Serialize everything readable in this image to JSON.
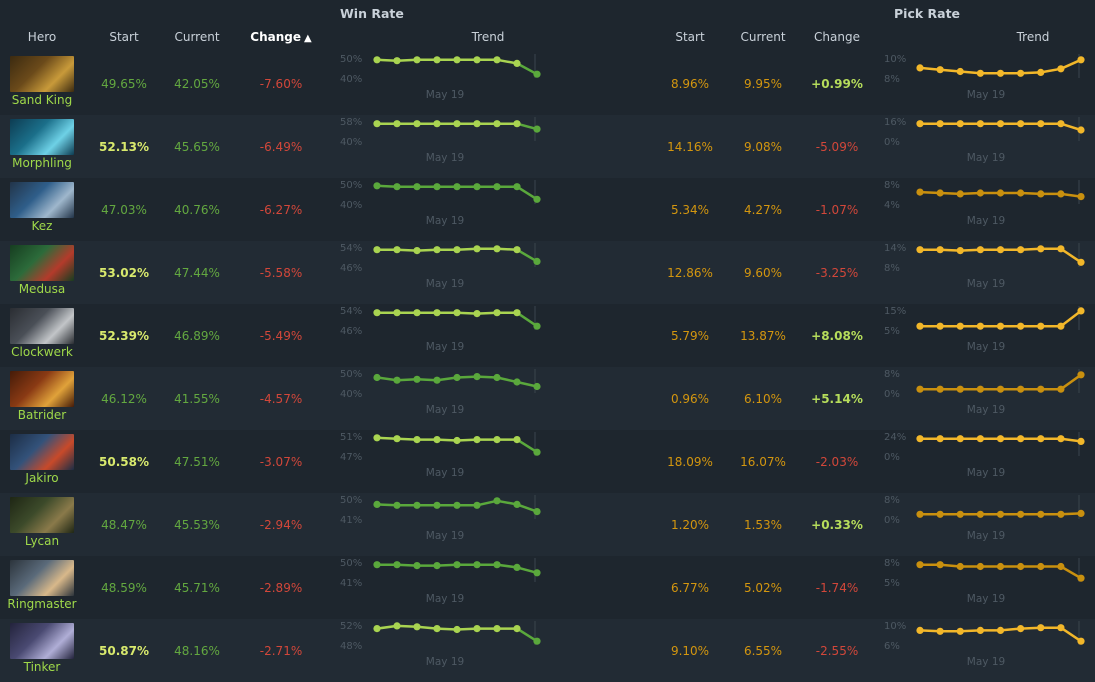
{
  "groups": {
    "win_rate": "Win Rate",
    "pick_rate": "Pick Rate"
  },
  "headers": {
    "hero": "Hero",
    "wr_start": "Start",
    "wr_current": "Current",
    "wr_change": "Change",
    "wr_trend": "Trend",
    "pr_start": "Start",
    "pr_current": "Current",
    "pr_change": "Change",
    "pr_trend": "Trend"
  },
  "sort_indicator": "▲",
  "colors": {
    "win_line": "#5aa83c",
    "win_last": "#b7e05a",
    "pick_line": "#c9900f",
    "pick_last": "#f2b72a",
    "negative": "#d2473a",
    "positive": "#b6dd5b"
  },
  "rows": [
    {
      "hero": "Sand King",
      "portrait": "sand-king",
      "wr_start": "49.65%",
      "wr_current": "42.05%",
      "wr_change": "-7.60%",
      "wr_hi": "50%",
      "wr_lo": "40%",
      "wr_date": "May 19",
      "pr_start": "8.96%",
      "pr_current": "9.95%",
      "pr_change": "+0.99%",
      "pr_hi": "10%",
      "pr_lo": "8%",
      "pr_date": "May 19",
      "wr_trend": [
        0.9,
        0.85,
        0.9,
        0.9,
        0.9,
        0.9,
        0.9,
        0.7,
        0.1
      ],
      "pr_trend": [
        0.45,
        0.35,
        0.25,
        0.15,
        0.15,
        0.15,
        0.2,
        0.4,
        0.9
      ],
      "wr_strong": false,
      "wr_bright": true,
      "pr_bright": true
    },
    {
      "hero": "Morphling",
      "portrait": "morphling",
      "wr_start": "52.13%",
      "wr_current": "45.65%",
      "wr_change": "-6.49%",
      "wr_hi": "58%",
      "wr_lo": "40%",
      "wr_date": "May 19",
      "pr_start": "14.16%",
      "pr_current": "9.08%",
      "pr_change": "-5.09%",
      "pr_hi": "16%",
      "pr_lo": "0%",
      "pr_date": "May 19",
      "wr_trend": [
        0.85,
        0.85,
        0.85,
        0.85,
        0.85,
        0.85,
        0.85,
        0.85,
        0.55
      ],
      "pr_trend": [
        0.85,
        0.85,
        0.85,
        0.85,
        0.85,
        0.85,
        0.85,
        0.85,
        0.5
      ],
      "wr_strong": true,
      "wr_bright": true,
      "pr_bright": true
    },
    {
      "hero": "Kez",
      "portrait": "kez",
      "wr_start": "47.03%",
      "wr_current": "40.76%",
      "wr_change": "-6.27%",
      "wr_hi": "50%",
      "wr_lo": "40%",
      "wr_date": "May 19",
      "pr_start": "5.34%",
      "pr_current": "4.27%",
      "pr_change": "-1.07%",
      "pr_hi": "8%",
      "pr_lo": "4%",
      "pr_date": "May 19",
      "wr_trend": [
        0.9,
        0.85,
        0.85,
        0.85,
        0.85,
        0.85,
        0.85,
        0.85,
        0.15
      ],
      "pr_trend": [
        0.55,
        0.5,
        0.45,
        0.5,
        0.5,
        0.5,
        0.45,
        0.45,
        0.3
      ],
      "wr_strong": false,
      "wr_bright": false,
      "pr_bright": false
    },
    {
      "hero": "Medusa",
      "portrait": "medusa",
      "wr_start": "53.02%",
      "wr_current": "47.44%",
      "wr_change": "-5.58%",
      "wr_hi": "54%",
      "wr_lo": "46%",
      "wr_date": "May 19",
      "pr_start": "12.86%",
      "pr_current": "9.60%",
      "pr_change": "-3.25%",
      "pr_hi": "14%",
      "pr_lo": "8%",
      "pr_date": "May 19",
      "wr_trend": [
        0.85,
        0.85,
        0.8,
        0.85,
        0.85,
        0.9,
        0.9,
        0.85,
        0.2
      ],
      "pr_trend": [
        0.85,
        0.85,
        0.8,
        0.85,
        0.85,
        0.85,
        0.9,
        0.9,
        0.15
      ],
      "wr_strong": true,
      "wr_bright": true,
      "pr_bright": true
    },
    {
      "hero": "Clockwerk",
      "portrait": "clockwerk",
      "wr_start": "52.39%",
      "wr_current": "46.89%",
      "wr_change": "-5.49%",
      "wr_hi": "54%",
      "wr_lo": "46%",
      "wr_date": "May 19",
      "pr_start": "5.79%",
      "pr_current": "13.87%",
      "pr_change": "+8.08%",
      "pr_hi": "15%",
      "pr_lo": "5%",
      "pr_date": "May 19",
      "wr_trend": [
        0.85,
        0.85,
        0.85,
        0.85,
        0.85,
        0.8,
        0.85,
        0.85,
        0.1
      ],
      "pr_trend": [
        0.1,
        0.1,
        0.1,
        0.1,
        0.1,
        0.1,
        0.1,
        0.1,
        0.95
      ],
      "wr_strong": true,
      "wr_bright": true,
      "pr_bright": true
    },
    {
      "hero": "Batrider",
      "portrait": "batrider",
      "wr_start": "46.12%",
      "wr_current": "41.55%",
      "wr_change": "-4.57%",
      "wr_hi": "50%",
      "wr_lo": "40%",
      "wr_date": "May 19",
      "pr_start": "0.96%",
      "pr_current": "6.10%",
      "pr_change": "+5.14%",
      "pr_hi": "8%",
      "pr_lo": "0%",
      "pr_date": "May 19",
      "wr_trend": [
        0.75,
        0.6,
        0.65,
        0.6,
        0.75,
        0.8,
        0.75,
        0.5,
        0.25
      ],
      "pr_trend": [
        0.1,
        0.1,
        0.1,
        0.1,
        0.1,
        0.1,
        0.1,
        0.1,
        0.9
      ],
      "wr_strong": false,
      "wr_bright": false,
      "pr_bright": false
    },
    {
      "hero": "Jakiro",
      "portrait": "jakiro",
      "wr_start": "50.58%",
      "wr_current": "47.51%",
      "wr_change": "-3.07%",
      "wr_hi": "51%",
      "wr_lo": "47%",
      "wr_date": "May 19",
      "pr_start": "18.09%",
      "pr_current": "16.07%",
      "pr_change": "-2.03%",
      "pr_hi": "24%",
      "pr_lo": "0%",
      "pr_date": "May 19",
      "wr_trend": [
        0.9,
        0.85,
        0.8,
        0.8,
        0.75,
        0.8,
        0.8,
        0.8,
        0.1
      ],
      "pr_trend": [
        0.85,
        0.85,
        0.85,
        0.85,
        0.85,
        0.85,
        0.85,
        0.85,
        0.7
      ],
      "wr_strong": true,
      "wr_bright": true,
      "pr_bright": true
    },
    {
      "hero": "Lycan",
      "portrait": "lycan",
      "wr_start": "48.47%",
      "wr_current": "45.53%",
      "wr_change": "-2.94%",
      "wr_hi": "50%",
      "wr_lo": "41%",
      "wr_date": "May 19",
      "pr_start": "1.20%",
      "pr_current": "1.53%",
      "pr_change": "+0.33%",
      "pr_hi": "8%",
      "pr_lo": "0%",
      "pr_date": "May 19",
      "wr_trend": [
        0.7,
        0.65,
        0.65,
        0.65,
        0.65,
        0.65,
        0.9,
        0.7,
        0.3
      ],
      "pr_trend": [
        0.15,
        0.15,
        0.15,
        0.15,
        0.15,
        0.15,
        0.15,
        0.15,
        0.2
      ],
      "wr_strong": false,
      "wr_bright": false,
      "pr_bright": false
    },
    {
      "hero": "Ringmaster",
      "portrait": "ringmaster",
      "wr_start": "48.59%",
      "wr_current": "45.71%",
      "wr_change": "-2.89%",
      "wr_hi": "50%",
      "wr_lo": "41%",
      "wr_date": "May 19",
      "pr_start": "6.77%",
      "pr_current": "5.02%",
      "pr_change": "-1.74%",
      "pr_hi": "8%",
      "pr_lo": "5%",
      "pr_date": "May 19",
      "wr_trend": [
        0.85,
        0.85,
        0.8,
        0.8,
        0.85,
        0.85,
        0.85,
        0.7,
        0.4
      ],
      "pr_trend": [
        0.85,
        0.85,
        0.75,
        0.75,
        0.75,
        0.75,
        0.75,
        0.75,
        0.1
      ],
      "wr_strong": false,
      "wr_bright": false,
      "pr_bright": false
    },
    {
      "hero": "Tinker",
      "portrait": "tinker",
      "wr_start": "50.87%",
      "wr_current": "48.16%",
      "wr_change": "-2.71%",
      "wr_hi": "52%",
      "wr_lo": "48%",
      "wr_date": "May 19",
      "pr_start": "9.10%",
      "pr_current": "6.55%",
      "pr_change": "-2.55%",
      "pr_hi": "10%",
      "pr_lo": "6%",
      "pr_date": "May 19",
      "wr_trend": [
        0.8,
        0.95,
        0.9,
        0.8,
        0.75,
        0.8,
        0.8,
        0.8,
        0.1
      ],
      "pr_trend": [
        0.7,
        0.65,
        0.65,
        0.7,
        0.7,
        0.8,
        0.85,
        0.85,
        0.1
      ],
      "wr_strong": true,
      "wr_bright": true,
      "pr_bright": true
    }
  ]
}
